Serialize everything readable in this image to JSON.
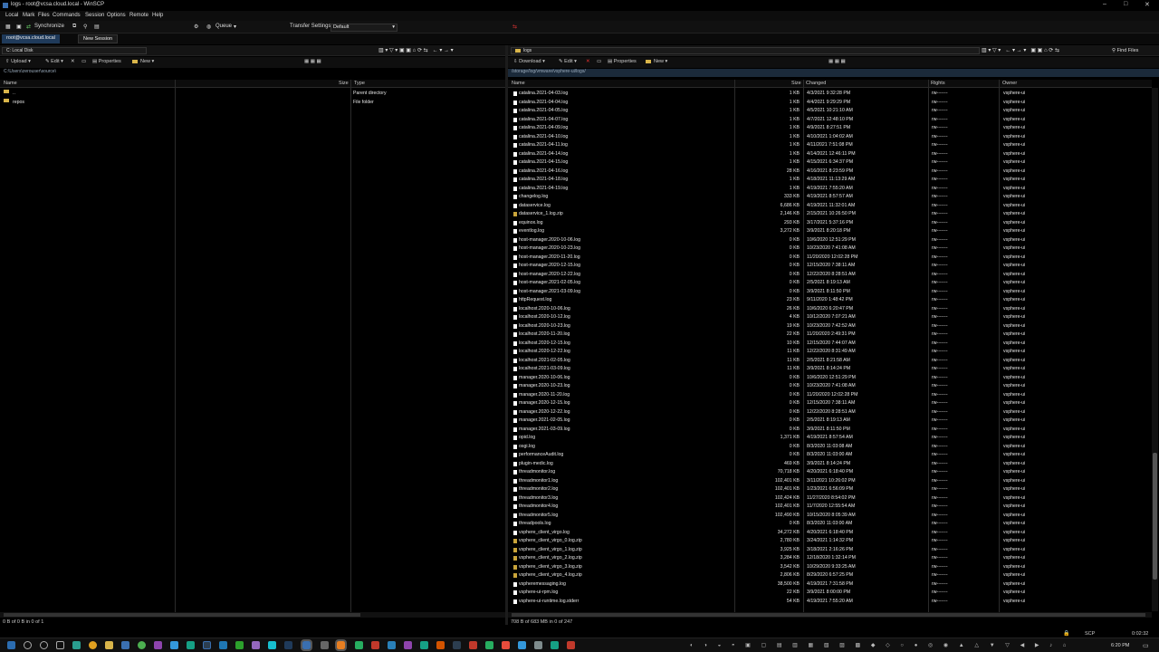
{
  "window": {
    "title": "logs - root@vcsa.cloud.local - WinSCP"
  },
  "menu": [
    "Local",
    "Mark",
    "Files",
    "Commands",
    "Session",
    "Options",
    "Remote",
    "Help"
  ],
  "toolbar": {
    "synchronize": "Synchronize",
    "queue": "Queue",
    "transfer_label": "Transfer Settings",
    "transfer_value": "Default"
  },
  "tabs": {
    "session": "root@vcsa.cloud.local",
    "new_session": "New Session"
  },
  "left": {
    "drive": "C: Local Disk",
    "actions": {
      "upload": "Upload",
      "edit": "Edit",
      "properties": "Properties",
      "new": "New"
    },
    "path": "C:\\Users\\zerouser\\source\\",
    "columns": {
      "name": "Name",
      "size": "Size",
      "type": "Type"
    },
    "rows": [
      {
        "name": "..",
        "size": "",
        "type": "Parent directory"
      },
      {
        "name": "repos",
        "size": "",
        "type": "File folder"
      }
    ],
    "status": "0 B of 0 B in 0 of 1"
  },
  "right": {
    "dir": "logs",
    "find_files": "Find Files",
    "actions": {
      "download": "Download",
      "edit": "Edit",
      "properties": "Properties",
      "new": "New"
    },
    "path": "/storage/log/vmware/vsphere-ui/logs/",
    "columns": {
      "name": "Name",
      "size": "Size",
      "changed": "Changed",
      "rights": "Rights",
      "owner": "Owner"
    },
    "rows": [
      {
        "name": "catalina.2021-04-03.log",
        "size": "1 KB",
        "changed": "4/3/2021 9:32:28 PM",
        "zip": false
      },
      {
        "name": "catalina.2021-04-04.log",
        "size": "1 KB",
        "changed": "4/4/2021 9:29:29 PM",
        "zip": false
      },
      {
        "name": "catalina.2021-04-05.log",
        "size": "1 KB",
        "changed": "4/5/2021 10:21:10 AM",
        "zip": false
      },
      {
        "name": "catalina.2021-04-07.log",
        "size": "1 KB",
        "changed": "4/7/2021 12:48:10 PM",
        "zip": false
      },
      {
        "name": "catalina.2021-04-09.log",
        "size": "1 KB",
        "changed": "4/9/2021 8:27:51 PM",
        "zip": false
      },
      {
        "name": "catalina.2021-04-10.log",
        "size": "1 KB",
        "changed": "4/10/2021 1:04:02 AM",
        "zip": false
      },
      {
        "name": "catalina.2021-04-11.log",
        "size": "1 KB",
        "changed": "4/11/2021 7:51:08 PM",
        "zip": false
      },
      {
        "name": "catalina.2021-04-14.log",
        "size": "1 KB",
        "changed": "4/14/2021 12:46:11 PM",
        "zip": false
      },
      {
        "name": "catalina.2021-04-15.log",
        "size": "1 KB",
        "changed": "4/15/2021 6:34:37 PM",
        "zip": false
      },
      {
        "name": "catalina.2021-04-16.log",
        "size": "28 KB",
        "changed": "4/16/2021 8:23:59 PM",
        "zip": false
      },
      {
        "name": "catalina.2021-04-18.log",
        "size": "1 KB",
        "changed": "4/18/2021 11:13:29 AM",
        "zip": false
      },
      {
        "name": "catalina.2021-04-19.log",
        "size": "1 KB",
        "changed": "4/19/2021 7:55:20 AM",
        "zip": false
      },
      {
        "name": "changelog.log",
        "size": "333 KB",
        "changed": "4/19/2021 8:57:57 AM",
        "zip": false
      },
      {
        "name": "dataservice.log",
        "size": "6,686 KB",
        "changed": "4/19/2021 11:32:01 AM",
        "zip": false
      },
      {
        "name": "dataservice_1.log.zip",
        "size": "2,146 KB",
        "changed": "2/15/2021 10:26:50 PM",
        "zip": true
      },
      {
        "name": "equinox.log",
        "size": "293 KB",
        "changed": "3/17/2021 5:37:16 PM",
        "zip": false
      },
      {
        "name": "eventlog.log",
        "size": "3,272 KB",
        "changed": "3/9/2021 8:20:18 PM",
        "zip": false
      },
      {
        "name": "host-manager.2020-10-06.log",
        "size": "0 KB",
        "changed": "10/6/2020 12:51:29 PM",
        "zip": false
      },
      {
        "name": "host-manager.2020-10-23.log",
        "size": "0 KB",
        "changed": "10/23/2020 7:41:08 AM",
        "zip": false
      },
      {
        "name": "host-manager.2020-11-20.log",
        "size": "0 KB",
        "changed": "11/20/2020 12:02:28 PM",
        "zip": false
      },
      {
        "name": "host-manager.2020-12-15.log",
        "size": "0 KB",
        "changed": "12/15/2020 7:38:11 AM",
        "zip": false
      },
      {
        "name": "host-manager.2020-12-22.log",
        "size": "0 KB",
        "changed": "12/22/2020 8:28:51 AM",
        "zip": false
      },
      {
        "name": "host-manager.2021-02-05.log",
        "size": "0 KB",
        "changed": "2/5/2021 8:19:13 AM",
        "zip": false
      },
      {
        "name": "host-manager.2021-03-09.log",
        "size": "0 KB",
        "changed": "3/9/2021 8:11:50 PM",
        "zip": false
      },
      {
        "name": "httpRequest.log",
        "size": "23 KB",
        "changed": "9/11/2020 1:48:42 PM",
        "zip": false
      },
      {
        "name": "localhost.2020-10-06.log",
        "size": "26 KB",
        "changed": "10/6/2020 6:20:47 PM",
        "zip": false
      },
      {
        "name": "localhost.2020-10-12.log",
        "size": "4 KB",
        "changed": "10/12/2020 7:07:21 AM",
        "zip": false
      },
      {
        "name": "localhost.2020-10-23.log",
        "size": "19 KB",
        "changed": "10/23/2020 7:42:52 AM",
        "zip": false
      },
      {
        "name": "localhost.2020-11-20.log",
        "size": "22 KB",
        "changed": "11/20/2020 2:49:31 PM",
        "zip": false
      },
      {
        "name": "localhost.2020-12-15.log",
        "size": "10 KB",
        "changed": "12/15/2020 7:44:07 AM",
        "zip": false
      },
      {
        "name": "localhost.2020-12-22.log",
        "size": "11 KB",
        "changed": "12/22/2020 8:31:49 AM",
        "zip": false
      },
      {
        "name": "localhost.2021-02-05.log",
        "size": "11 KB",
        "changed": "2/5/2021 8:21:58 AM",
        "zip": false
      },
      {
        "name": "localhost.2021-03-09.log",
        "size": "11 KB",
        "changed": "3/9/2021 8:14:24 PM",
        "zip": false
      },
      {
        "name": "manager.2020-10-06.log",
        "size": "0 KB",
        "changed": "10/6/2020 12:51:29 PM",
        "zip": false
      },
      {
        "name": "manager.2020-10-23.log",
        "size": "0 KB",
        "changed": "10/23/2020 7:41:08 AM",
        "zip": false
      },
      {
        "name": "manager.2020-11-20.log",
        "size": "0 KB",
        "changed": "11/20/2020 12:02:28 PM",
        "zip": false
      },
      {
        "name": "manager.2020-12-15.log",
        "size": "0 KB",
        "changed": "12/15/2020 7:38:11 AM",
        "zip": false
      },
      {
        "name": "manager.2020-12-22.log",
        "size": "0 KB",
        "changed": "12/22/2020 8:28:51 AM",
        "zip": false
      },
      {
        "name": "manager.2021-02-05.log",
        "size": "0 KB",
        "changed": "2/5/2021 8:19:13 AM",
        "zip": false
      },
      {
        "name": "manager.2021-03-09.log",
        "size": "0 KB",
        "changed": "3/9/2021 8:11:50 PM",
        "zip": false
      },
      {
        "name": "opid.log",
        "size": "1,371 KB",
        "changed": "4/19/2021 8:57:54 AM",
        "zip": false
      },
      {
        "name": "osgi.log",
        "size": "0 KB",
        "changed": "8/3/2020 11:03:08 AM",
        "zip": false
      },
      {
        "name": "performanceAudit.log",
        "size": "0 KB",
        "changed": "8/3/2020 11:03:00 AM",
        "zip": false
      },
      {
        "name": "plugin-medic.log",
        "size": "469 KB",
        "changed": "3/9/2021 8:14:24 PM",
        "zip": false
      },
      {
        "name": "threadmonitor.log",
        "size": "70,718 KB",
        "changed": "4/20/2021 6:18:40 PM",
        "zip": false
      },
      {
        "name": "threadmonitor1.log",
        "size": "102,401 KB",
        "changed": "3/11/2021 10:26:02 PM",
        "zip": false
      },
      {
        "name": "threadmonitor2.log",
        "size": "102,401 KB",
        "changed": "1/23/2021 6:56:09 PM",
        "zip": false
      },
      {
        "name": "threadmonitor3.log",
        "size": "102,424 KB",
        "changed": "11/27/2020 8:54:02 PM",
        "zip": false
      },
      {
        "name": "threadmonitor4.log",
        "size": "102,401 KB",
        "changed": "11/7/2020 12:55:54 AM",
        "zip": false
      },
      {
        "name": "threadmonitor5.log",
        "size": "102,490 KB",
        "changed": "10/15/2020 8:05:39 AM",
        "zip": false
      },
      {
        "name": "threadpools.log",
        "size": "0 KB",
        "changed": "8/3/2020 11:03:00 AM",
        "zip": false
      },
      {
        "name": "vsphere_client_virgo.log",
        "size": "34,272 KB",
        "changed": "4/20/2021 6:18:40 PM",
        "zip": false
      },
      {
        "name": "vsphere_client_virgo_0.log.zip",
        "size": "2,780 KB",
        "changed": "3/24/2021 1:14:32 PM",
        "zip": true
      },
      {
        "name": "vsphere_client_virgo_1.log.zip",
        "size": "3,925 KB",
        "changed": "3/18/2021 2:16:26 PM",
        "zip": true
      },
      {
        "name": "vsphere_client_virgo_2.log.zip",
        "size": "3,284 KB",
        "changed": "12/18/2020 1:32:14 PM",
        "zip": true
      },
      {
        "name": "vsphere_client_virgo_3.log.zip",
        "size": "3,542 KB",
        "changed": "10/29/2020 9:33:25 AM",
        "zip": true
      },
      {
        "name": "vsphere_client_virgo_4.log.zip",
        "size": "2,806 KB",
        "changed": "8/29/2020 6:57:25 PM",
        "zip": true
      },
      {
        "name": "vspheremessaging.log",
        "size": "38,500 KB",
        "changed": "4/19/2021 7:31:58 PM",
        "zip": false
      },
      {
        "name": "vsphere-ui-rpm.log",
        "size": "22 KB",
        "changed": "3/9/2021 8:00:00 PM",
        "zip": false
      },
      {
        "name": "vsphere-ui-runtime.log.stderr",
        "size": "54 KB",
        "changed": "4/19/2021 7:55:20 AM",
        "zip": false
      }
    ],
    "rights": "rw-------",
    "owner": "vsphere-ui",
    "status": "708 B of 683 MB in 0 of 247"
  },
  "taskbar": {
    "clock_time": "6:20 PM",
    "stat_time": "0:02:32",
    "protocol": "SCP"
  }
}
